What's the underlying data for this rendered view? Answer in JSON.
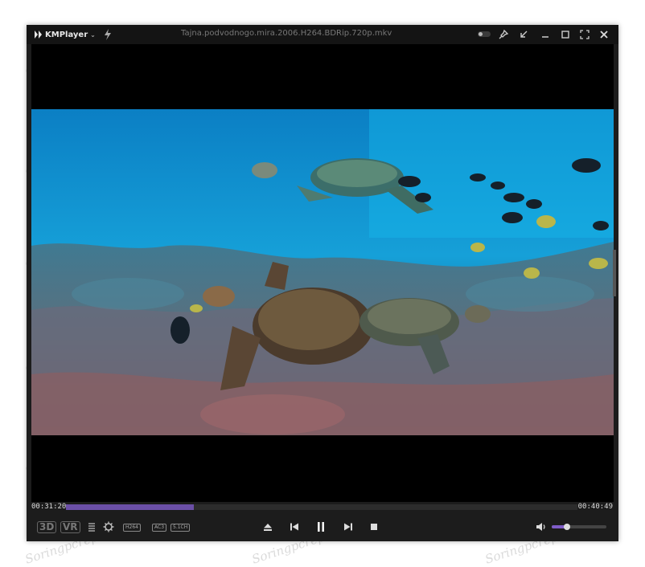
{
  "app": {
    "name": "KMPlayer"
  },
  "window": {
    "title": "Tajna.podvodnogo.mira.2006.H264.BDRip.720p.mkv"
  },
  "titlebar": {
    "icons": [
      "bolt-icon",
      "toggle",
      "pin-icon",
      "shrink-icon",
      "minimize-icon",
      "maximize-icon",
      "fullscreen-icon",
      "close-icon"
    ]
  },
  "playback": {
    "current_time": "00:31:20",
    "total_time": "00:40:49",
    "progress": 0.25,
    "volume": 0.28
  },
  "controls": {
    "left": {
      "three_d": "3D",
      "vr": "VR"
    },
    "codecs": [
      "H264",
      "AC3",
      "5.1CH"
    ],
    "buttons": [
      "eject-icon",
      "previous-icon",
      "pause-icon",
      "next-icon",
      "stop-icon"
    ]
  },
  "watermark": "Soringpcrepair.com",
  "colors": {
    "accent": "#6b4fa6",
    "background": "#1c1c1c",
    "water": "#1aa6d6"
  }
}
